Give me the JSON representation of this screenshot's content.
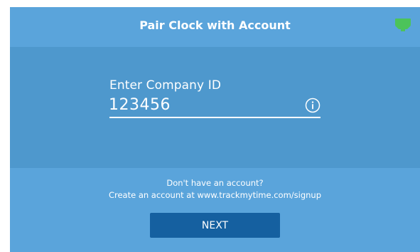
{
  "header": {
    "title": "Pair Clock with Account",
    "status_icon": "network-connected-icon"
  },
  "form": {
    "label": "Enter Company ID",
    "value": "123456",
    "info_icon": "info-icon"
  },
  "footer": {
    "line1": "Don't have an account?",
    "line2": "Create an account at www.trackmytime.com/signup"
  },
  "next_button": {
    "label": "NEXT"
  },
  "colors": {
    "background": "#5aa4db",
    "panel": "#4e98cd",
    "button": "#1560a0",
    "status_icon": "#4cc35a",
    "text": "#ffffff"
  }
}
